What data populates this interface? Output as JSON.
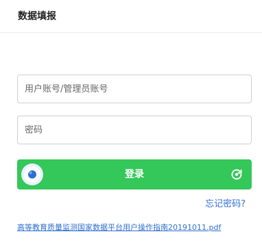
{
  "header": {
    "title": "数据填报"
  },
  "login_form": {
    "username_placeholder": "用户账号/管理员账号",
    "password_placeholder": "密码",
    "login_button_label": "登录",
    "slider_icon": "circle-slider-icon",
    "refresh_icon": "refresh-icon"
  },
  "links": {
    "forgot_password": "忘记密码?",
    "manual": "高等教育质量监测国家数据平台用户操作指南20191011.pdf"
  },
  "colors": {
    "accent_green": "#34c759",
    "link_blue": "#2f6fd0"
  }
}
